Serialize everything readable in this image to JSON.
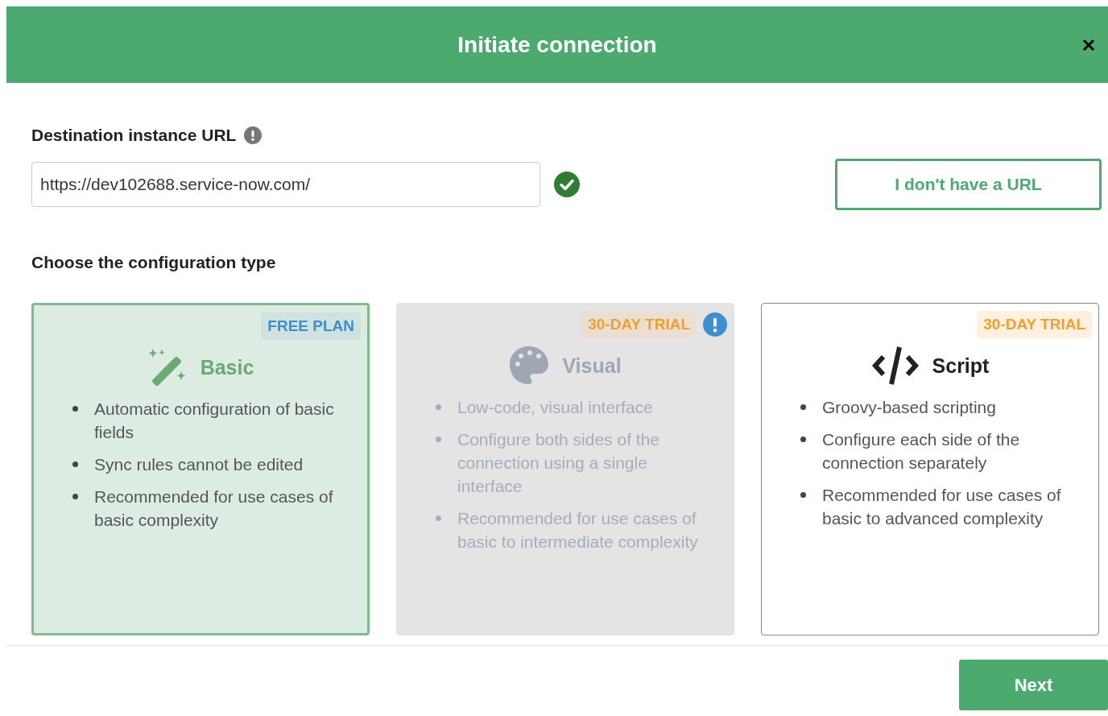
{
  "dialog": {
    "title": "Initiate connection"
  },
  "url_field": {
    "label": "Destination instance URL",
    "value": "https://dev102688.service-now.com/",
    "valid": true
  },
  "no_url_button": "I don't have a URL",
  "config_heading": "Choose the configuration type",
  "cards": [
    {
      "kind": "basic",
      "title": "Basic",
      "badge": {
        "kind": "free",
        "text": "FREE PLAN"
      },
      "info": false,
      "selected": true,
      "disabled": false,
      "bullets": [
        "Automatic configuration of basic fields",
        "Sync rules cannot be edited",
        "Recommended for use cases of basic complexity"
      ]
    },
    {
      "kind": "visual",
      "title": "Visual",
      "badge": {
        "kind": "trial",
        "text": "30-DAY TRIAL"
      },
      "info": true,
      "selected": false,
      "disabled": true,
      "bullets": [
        "Low-code, visual interface",
        "Configure both sides of the connection using a single interface",
        "Recommended for use cases of basic to intermediate complexity"
      ]
    },
    {
      "kind": "script",
      "title": "Script",
      "badge": {
        "kind": "trial",
        "text": "30-DAY TRIAL"
      },
      "info": false,
      "selected": false,
      "disabled": false,
      "bullets": [
        "Groovy-based scripting",
        "Configure each side of the connection separately",
        "Recommended for use cases of basic to advanced complexity"
      ]
    }
  ],
  "next_button": "Next"
}
